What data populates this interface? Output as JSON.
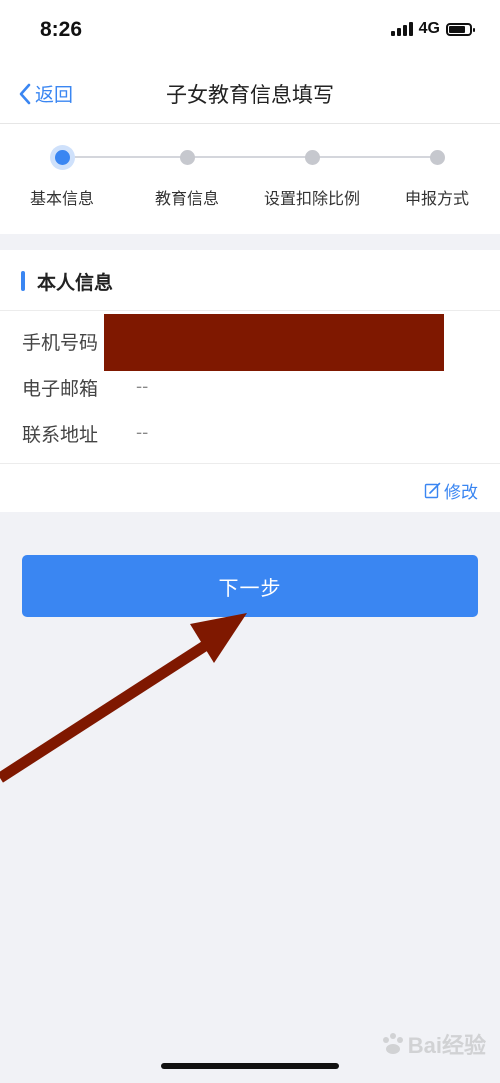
{
  "status_bar": {
    "time": "8:26",
    "network": "4G"
  },
  "nav": {
    "back_label": "返回",
    "title": "子女教育信息填写"
  },
  "steps": [
    {
      "label": "基本信息",
      "active": true
    },
    {
      "label": "教育信息",
      "active": false
    },
    {
      "label": "设置扣除比例",
      "active": false
    },
    {
      "label": "申报方式",
      "active": false
    }
  ],
  "info": {
    "section_title": "本人信息",
    "fields": [
      {
        "label": "手机号码",
        "value": ""
      },
      {
        "label": "电子邮箱",
        "value": "--"
      },
      {
        "label": "联系地址",
        "value": "--"
      }
    ],
    "edit_label": "修改"
  },
  "next_button": {
    "label": "下一步"
  },
  "watermark": {
    "text": "Bai经验"
  },
  "colors": {
    "accent": "#3a86f2",
    "redaction": "#7f1800",
    "arrow": "#7f1800"
  }
}
